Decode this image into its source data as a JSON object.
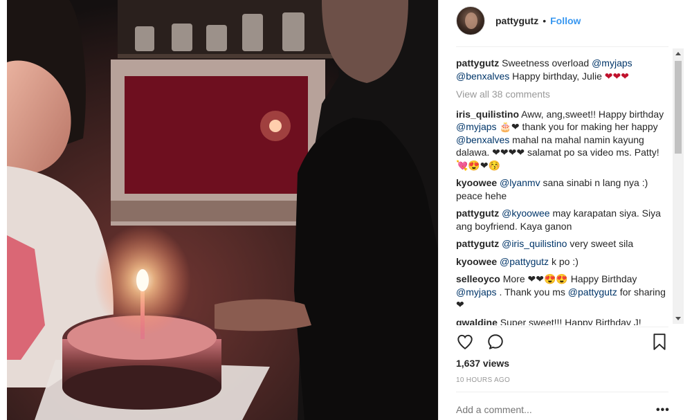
{
  "post": {
    "username": "pattygutz",
    "separator": "•",
    "follow_label": "Follow",
    "caption": {
      "user": "pattygutz",
      "parts": [
        {
          "t": " Sweetness overload "
        },
        {
          "m": "@myjaps"
        },
        {
          "t": " "
        },
        {
          "m": "@benxalves"
        },
        {
          "t": " Happy birthday, Julie "
        },
        {
          "h": "❤❤❤"
        }
      ]
    },
    "view_all_label": "View all 38 comments",
    "comments": [
      {
        "user": "iris_quilistino",
        "parts": [
          {
            "t": " Aww, ang,sweet!! Happy birthday "
          },
          {
            "m": "@myjaps"
          },
          {
            "t": " 🎂❤ thank you for making her happy "
          },
          {
            "m": "@benxalves"
          },
          {
            "t": " mahal na mahal namin kayung dalawa. ❤❤❤❤ salamat po sa video ms. Patty! 💘😍❤😚"
          }
        ]
      },
      {
        "user": "kyoowee",
        "parts": [
          {
            "t": " "
          },
          {
            "m": "@lyanmv"
          },
          {
            "t": " sana sinabi n lang nya :) peace hehe"
          }
        ]
      },
      {
        "user": "pattygutz",
        "parts": [
          {
            "t": " "
          },
          {
            "m": "@kyoowee"
          },
          {
            "t": " may karapatan siya. Siya ang boyfriend. Kaya ganon"
          }
        ]
      },
      {
        "user": "pattygutz",
        "parts": [
          {
            "t": " "
          },
          {
            "m": "@iris_quilistino"
          },
          {
            "t": " very sweet sila"
          }
        ]
      },
      {
        "user": "kyoowee",
        "parts": [
          {
            "t": " "
          },
          {
            "m": "@pattygutz"
          },
          {
            "t": " k po :)"
          }
        ]
      },
      {
        "user": "selleoyco",
        "parts": [
          {
            "t": " More ❤❤😍😍 Happy Birthday "
          },
          {
            "m": "@myjaps"
          },
          {
            "t": " . Thank you ms "
          },
          {
            "m": "@pattygutz"
          },
          {
            "t": " for sharing ❤"
          }
        ]
      },
      {
        "user": "gwaldine",
        "parts": [
          {
            "t": " Super sweet!!! Happy Birthday J!"
          }
        ]
      }
    ],
    "views_label": "1,637 views",
    "time_label": "10 HOURS AGO",
    "add_comment_placeholder": "Add a comment...",
    "more_label": "•••"
  },
  "icons": {
    "like": "heart-outline-icon",
    "comment": "comment-bubble-icon",
    "save": "bookmark-icon",
    "more": "more-options-icon"
  },
  "colors": {
    "link": "#3897f0",
    "mention": "#003569",
    "muted": "#999999",
    "heart": "#c0122d"
  }
}
